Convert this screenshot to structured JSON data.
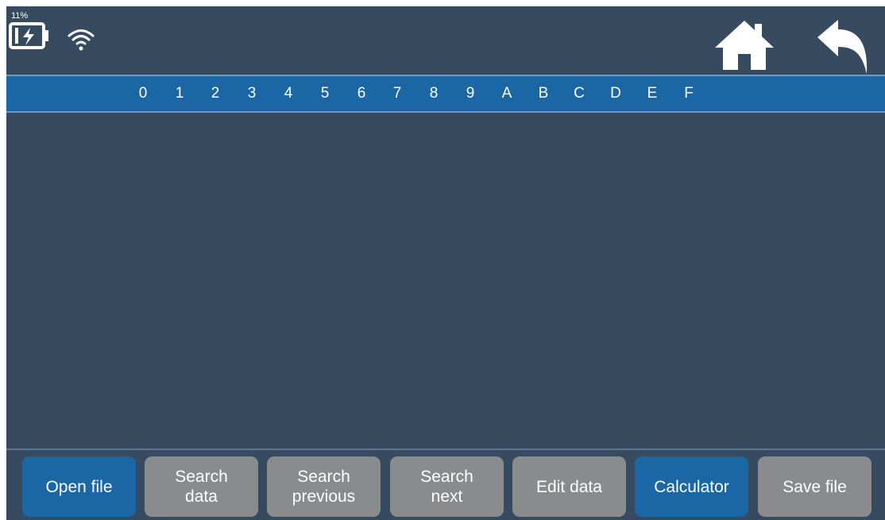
{
  "status_bar": {
    "battery_percent": "11%",
    "icons": [
      "battery-charging-icon",
      "wifi-icon"
    ]
  },
  "nav": {
    "icons": [
      "home-icon",
      "back-icon"
    ]
  },
  "hex_header": {
    "columns": [
      "0",
      "1",
      "2",
      "3",
      "4",
      "5",
      "6",
      "7",
      "8",
      "9",
      "A",
      "B",
      "C",
      "D",
      "E",
      "F"
    ]
  },
  "toolbar": {
    "buttons": [
      {
        "label": "Open file",
        "state": "active"
      },
      {
        "label": "Search\ndata",
        "state": "inactive"
      },
      {
        "label": "Search\nprevious",
        "state": "inactive"
      },
      {
        "label": "Search\nnext",
        "state": "inactive"
      },
      {
        "label": "Edit data",
        "state": "inactive"
      },
      {
        "label": "Calculator",
        "state": "active"
      },
      {
        "label": "Save file",
        "state": "inactive"
      }
    ]
  },
  "colors": {
    "background": "#364a60",
    "header_blue": "#1b66a4",
    "button_active": "#1b66a4",
    "button_inactive": "#8a8b8d",
    "text": "#ffffff"
  }
}
